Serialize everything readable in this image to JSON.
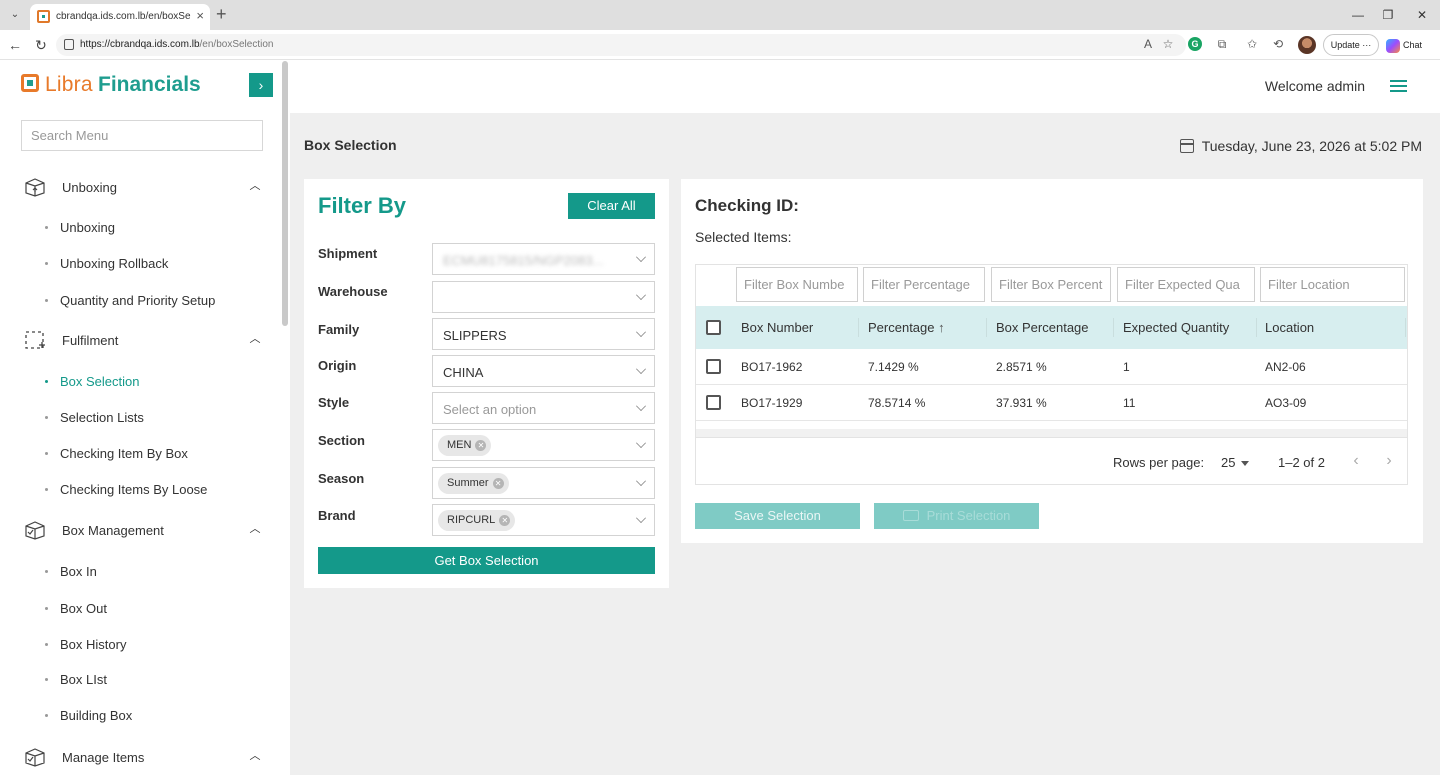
{
  "browser": {
    "tab_title": "cbrandqa.ids.com.lb/en/boxSelecti",
    "url_host": "https://cbrandqa.ids.com.lb",
    "url_path": "/en/boxSelection",
    "update_label": "Update ···",
    "chat_label": "Chat"
  },
  "sidebar": {
    "logo_part1": "Libra",
    "logo_part2": "Financials",
    "search_placeholder": "Search Menu",
    "groups": [
      {
        "label": "Unboxing",
        "items": [
          "Unboxing",
          "Unboxing Rollback",
          "Quantity and Priority Setup"
        ]
      },
      {
        "label": "Fulfilment",
        "items": [
          "Box Selection",
          "Selection Lists",
          "Checking Item By Box",
          "Checking Items By Loose"
        ]
      },
      {
        "label": "Box Management",
        "items": [
          "Box In",
          "Box Out",
          "Box History",
          "Box LIst",
          "Building Box"
        ]
      },
      {
        "label": "Manage Items",
        "items": []
      }
    ],
    "active_item": "Box Selection"
  },
  "header": {
    "welcome": "Welcome admin"
  },
  "page": {
    "title": "Box Selection",
    "datetime": "Tuesday, June 23, 2026 at 5:02 PM"
  },
  "filter": {
    "title": "Filter By",
    "clear_all": "Clear All",
    "fields": {
      "shipment": {
        "label": "Shipment",
        "value": "ECMU8175815/NGP2083..."
      },
      "warehouse": {
        "label": "Warehouse",
        "value": ""
      },
      "family": {
        "label": "Family",
        "value": "SLIPPERS"
      },
      "origin": {
        "label": "Origin",
        "value": "CHINA"
      },
      "style": {
        "label": "Style",
        "placeholder": "Select an option"
      },
      "section": {
        "label": "Section",
        "chip": "MEN"
      },
      "season": {
        "label": "Season",
        "chip": "Summer"
      },
      "brand": {
        "label": "Brand",
        "chip": "RIPCURL"
      }
    },
    "get_button": "Get Box Selection"
  },
  "checking": {
    "title": "Checking ID:",
    "selected_items": "Selected Items:",
    "filters": [
      "Filter Box Numbe",
      "Filter Percentage",
      "Filter Box Percent",
      "Filter Expected Qua",
      "Filter Location"
    ],
    "columns": [
      "Box Number",
      "Percentage",
      "Box Percentage",
      "Expected Quantity",
      "Location"
    ],
    "sort_icon": "↑",
    "rows": [
      [
        "BO17-1962",
        "7.1429 %",
        "2.8571 %",
        "1",
        "AN2-06"
      ],
      [
        "BO17-1929",
        "78.5714 %",
        "37.931 %",
        "11",
        "AO3-09"
      ]
    ],
    "rows_per_page_label": "Rows per page:",
    "rows_per_page": "25",
    "range": "1–2 of 2",
    "save_button": "Save Selection",
    "print_button": "Print Selection"
  },
  "colors": {
    "accent": "#14998a",
    "logo_orange": "#e87a2a",
    "header_bg": "#d7eeef"
  }
}
